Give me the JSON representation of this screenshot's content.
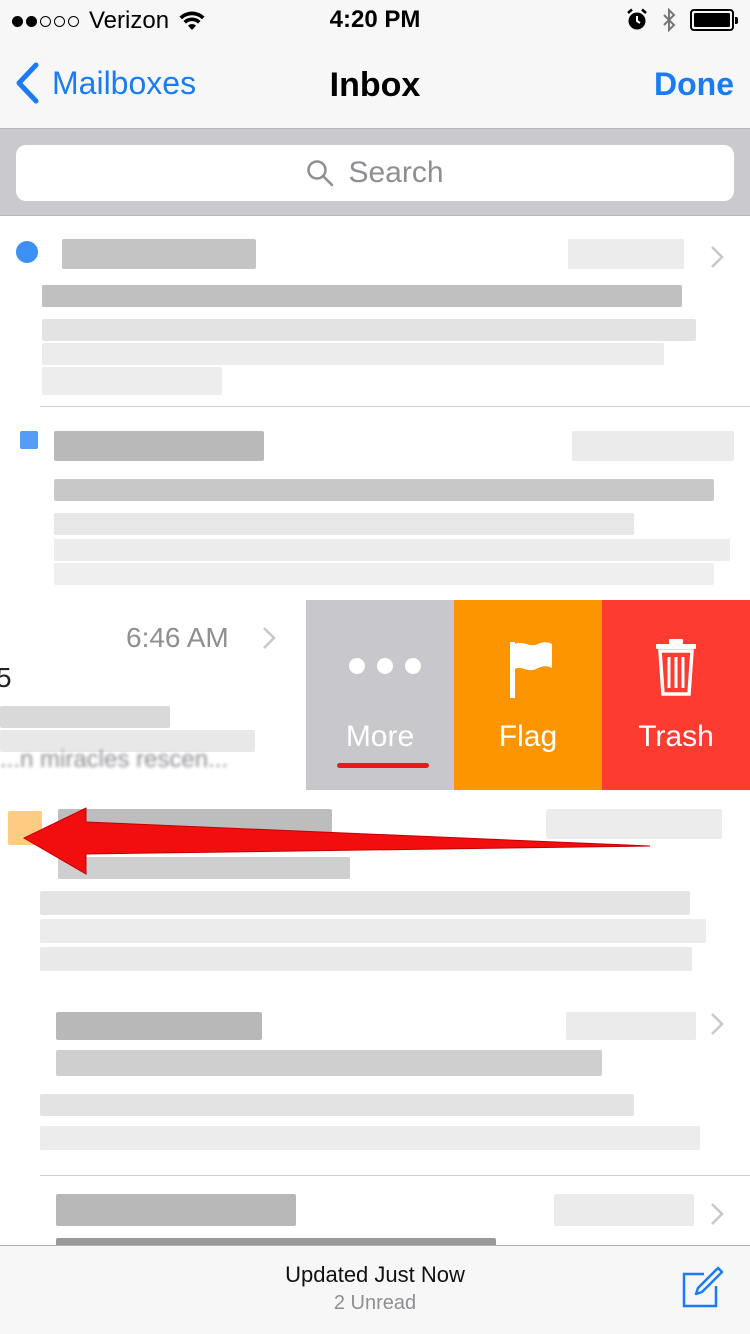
{
  "status_bar": {
    "carrier": "Verizon",
    "time": "4:20 PM",
    "signal_bars_filled": 2,
    "signal_bars_total": 5
  },
  "nav": {
    "back_label": "Mailboxes",
    "title": "Inbox",
    "done_label": "Done"
  },
  "search": {
    "placeholder": "Search"
  },
  "swiped_message": {
    "time": "6:46 AM",
    "digit": "5",
    "snippet": "...n miracles rescen..."
  },
  "actions": {
    "more_label": "More",
    "flag_label": "Flag",
    "trash_label": "Trash"
  },
  "toolbar": {
    "updated": "Updated Just Now",
    "unread": "2 Unread"
  },
  "colors": {
    "ios_blue": "#1a7cf5",
    "more_gray": "#c7c7cc",
    "flag_orange": "#fd9500",
    "trash_red": "#fd3b30",
    "annotation_red": "#e8191b"
  },
  "icons": [
    "wifi-icon",
    "alarm-icon",
    "bluetooth-icon",
    "battery-icon",
    "back-chevron-icon",
    "search-icon",
    "disclosure-chevron-icon",
    "more-dots-icon",
    "flag-icon",
    "trash-icon",
    "compose-icon"
  ]
}
